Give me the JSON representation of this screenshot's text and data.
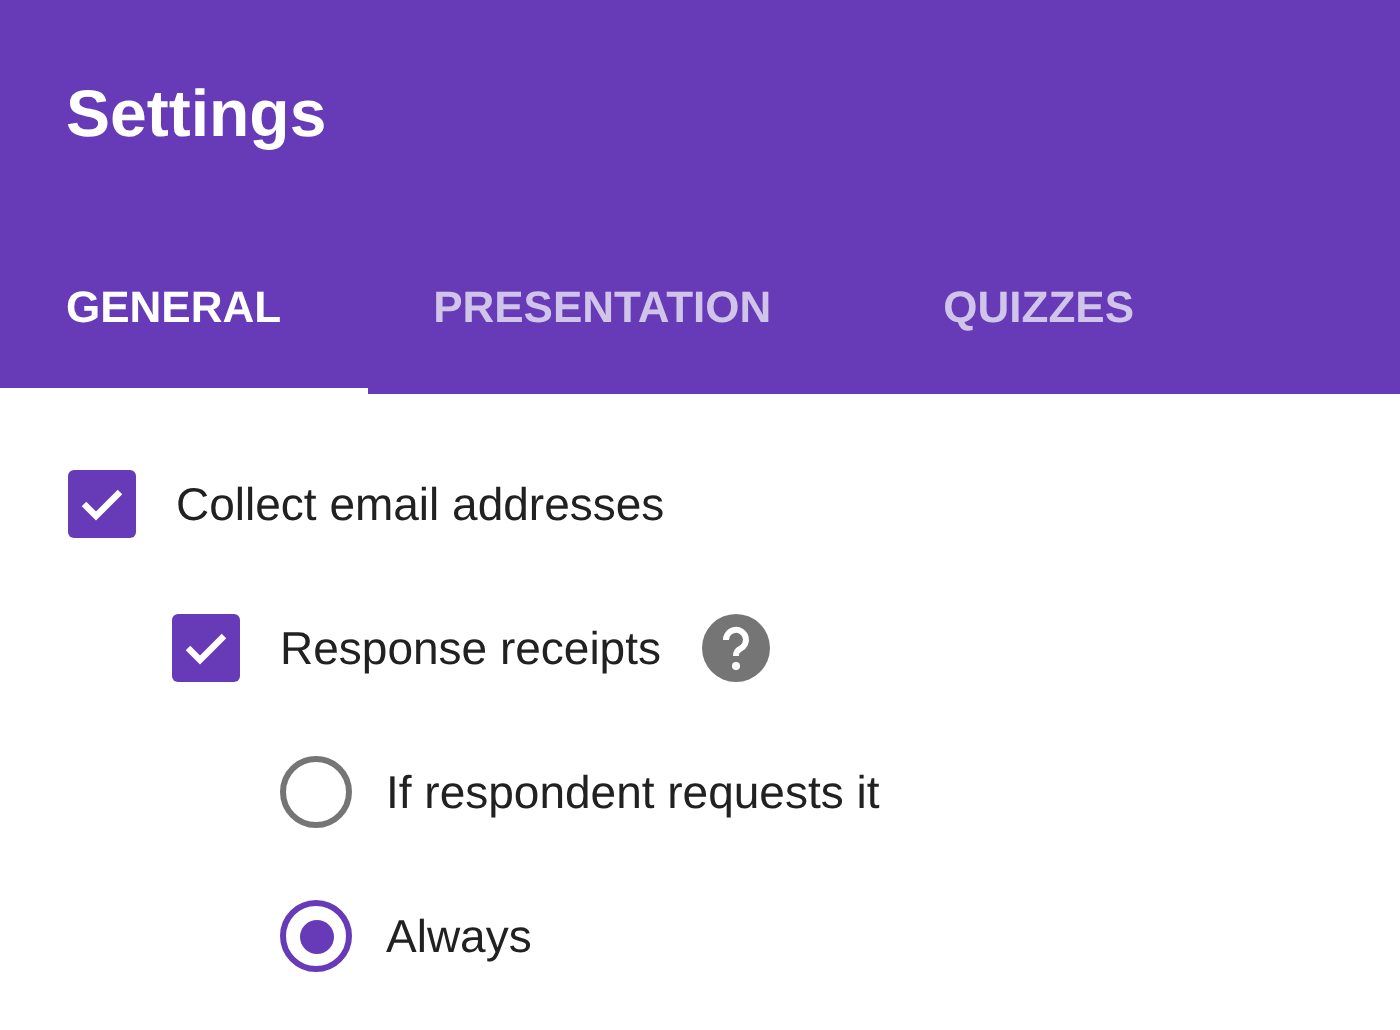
{
  "header": {
    "title": "Settings"
  },
  "tabs": [
    {
      "label": "GENERAL",
      "selected": true
    },
    {
      "label": "PRESENTATION",
      "selected": false
    },
    {
      "label": "QUIZZES",
      "selected": false
    }
  ],
  "settings": [
    {
      "kind": "checkbox",
      "label": "Collect email addresses",
      "checked": true,
      "children": [
        {
          "kind": "checkbox",
          "label": "Response receipts",
          "checked": true,
          "help": true,
          "children": [
            {
              "kind": "radio",
              "label": "If respondent requests it",
              "selected": false
            },
            {
              "kind": "radio",
              "label": "Always",
              "selected": true
            }
          ]
        }
      ]
    }
  ]
}
